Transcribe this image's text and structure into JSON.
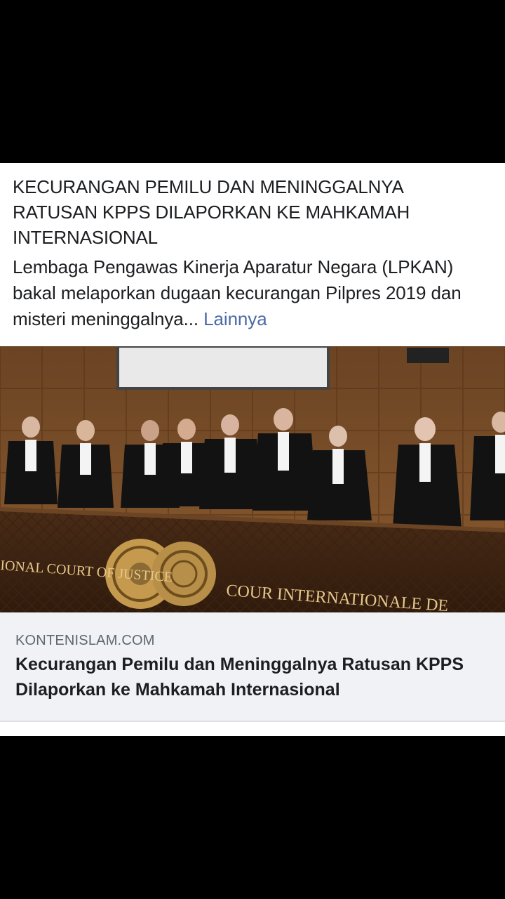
{
  "post": {
    "headline": "KECURANGAN PEMILU DAN MENINGGALNYA RATUSAN KPPS DILAPORKAN KE MAHKAMAH INTERNASIONAL",
    "body": "Lembaga Pengawas Kinerja Aparatur Negara (LPKAN) bakal melaporkan dugaan kecurangan Pilpres 2019 dan misteri meninggalnya...",
    "more_label": "Lainnya"
  },
  "photo": {
    "bench_text_left": "IONAL COURT OF JUSTICE",
    "bench_text_right": "COUR INTERNATIONALE DE"
  },
  "link": {
    "domain": "KONTENISLAM.COM",
    "title": "Kecurangan Pemilu dan Meninggalnya Ratusan KPPS Dilaporkan ke Mahkamah Internasional"
  }
}
